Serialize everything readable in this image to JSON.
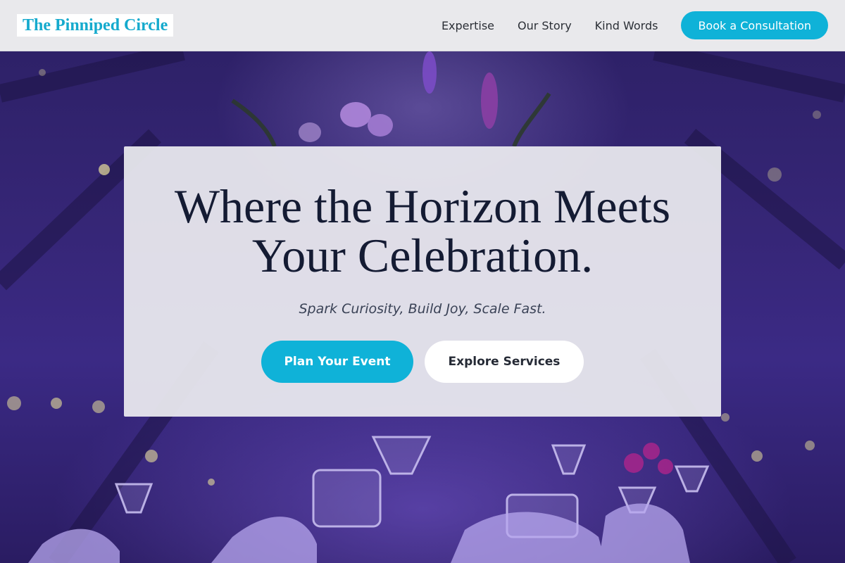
{
  "brand": {
    "name": "The Pinniped Circle"
  },
  "nav": {
    "links": [
      "Expertise",
      "Our Story",
      "Kind Words"
    ],
    "cta": "Book a Consultation"
  },
  "hero": {
    "title": "Where the Horizon Meets Your Celebration.",
    "subtitle": "Spark Curiosity, Build Joy, Scale Fast.",
    "primary_button": "Plan Your Event",
    "secondary_button": "Explore Services"
  },
  "colors": {
    "accent": "#0fb2d8",
    "header_bg": "#e9e9ec",
    "title_text": "#141b33",
    "hero_bg": "#362677"
  }
}
